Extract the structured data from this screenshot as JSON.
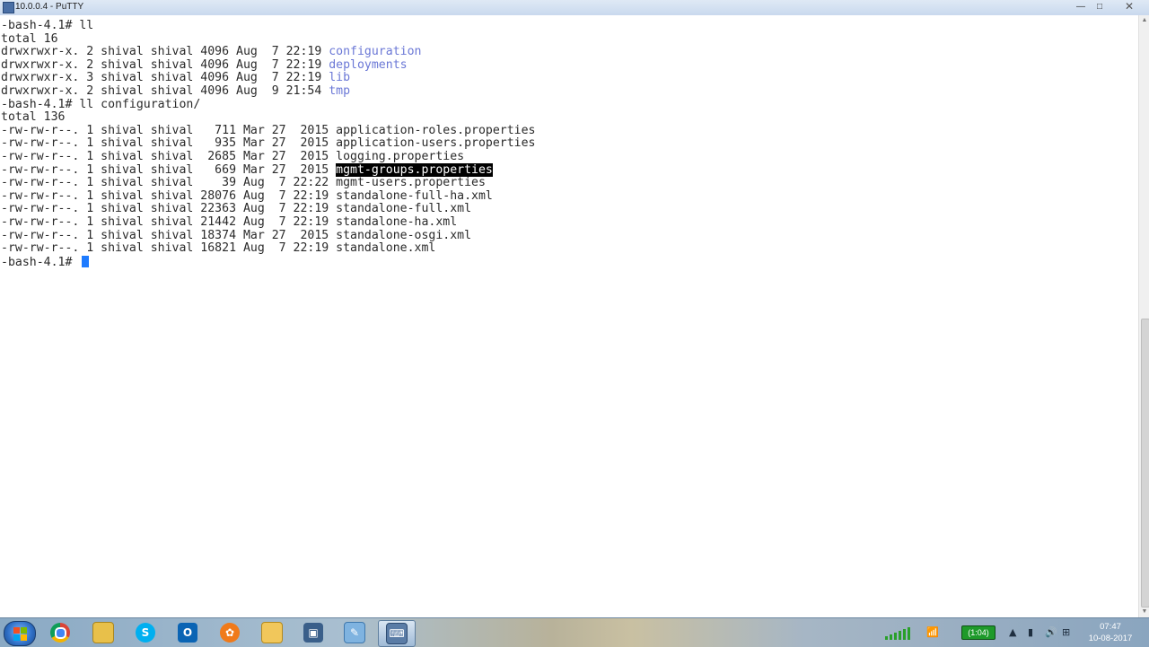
{
  "window": {
    "title": "10.0.0.4 - PuTTY",
    "minimize": "—",
    "maximize": "□",
    "close": "✕"
  },
  "terminal": {
    "lines": [
      {
        "text": "-bash-4.1# ll"
      },
      {
        "text": "total 16"
      },
      {
        "prefix": "drwxrwxr-x. 2 shival shival 4096 Aug  7 22:19 ",
        "name": "configuration",
        "type": "dir"
      },
      {
        "prefix": "drwxrwxr-x. 2 shival shival 4096 Aug  7 22:19 ",
        "name": "deployments",
        "type": "dir"
      },
      {
        "prefix": "drwxrwxr-x. 3 shival shival 4096 Aug  7 22:19 ",
        "name": "lib",
        "type": "dir"
      },
      {
        "prefix": "drwxrwxr-x. 2 shival shival 4096 Aug  9 21:54 ",
        "name": "tmp",
        "type": "dir"
      },
      {
        "text": "-bash-4.1# ll configuration/"
      },
      {
        "text": "total 136"
      },
      {
        "prefix": "-rw-rw-r--. 1 shival shival   711 Mar 27  2015 ",
        "name": "application-roles.properties",
        "type": "file"
      },
      {
        "prefix": "-rw-rw-r--. 1 shival shival   935 Mar 27  2015 ",
        "name": "application-users.properties",
        "type": "file"
      },
      {
        "prefix": "-rw-rw-r--. 1 shival shival  2685 Mar 27  2015 ",
        "name": "logging.properties",
        "type": "file"
      },
      {
        "prefix": "-rw-rw-r--. 1 shival shival   669 Mar 27  2015 ",
        "name": "mgmt-groups.properties",
        "type": "selected"
      },
      {
        "prefix": "-rw-rw-r--. 1 shival shival    39 Aug  7 22:22 ",
        "name": "mgmt-users.properties",
        "type": "file"
      },
      {
        "prefix": "-rw-rw-r--. 1 shival shival 28076 Aug  7 22:19 ",
        "name": "standalone-full-ha.xml",
        "type": "file"
      },
      {
        "prefix": "-rw-rw-r--. 1 shival shival 22363 Aug  7 22:19 ",
        "name": "standalone-full.xml",
        "type": "file"
      },
      {
        "prefix": "-rw-rw-r--. 1 shival shival 21442 Aug  7 22:19 ",
        "name": "standalone-ha.xml",
        "type": "file"
      },
      {
        "prefix": "-rw-rw-r--. 1 shival shival 18374 Mar 27  2015 ",
        "name": "standalone-osgi.xml",
        "type": "file"
      },
      {
        "prefix": "-rw-rw-r--. 1 shival shival 16821 Aug  7 22:19 ",
        "name": "standalone.xml",
        "type": "file"
      },
      {
        "text": "-bash-4.1# ",
        "cursor": true
      }
    ],
    "colors": {
      "dir": "#6b78d6",
      "text": "#2a2a2a",
      "cursor": "#1e7bff"
    }
  },
  "taskbar": {
    "apps": [
      "start-button",
      "chrome-icon",
      "explorer-icon",
      "skype-icon",
      "outlook-icon",
      "app-icon",
      "folder-icon",
      "vmware-icon",
      "notepad-icon",
      "putty-icon"
    ],
    "battery": "(1:04)",
    "clock_time": "07:47",
    "clock_date": "10-08-2017"
  }
}
